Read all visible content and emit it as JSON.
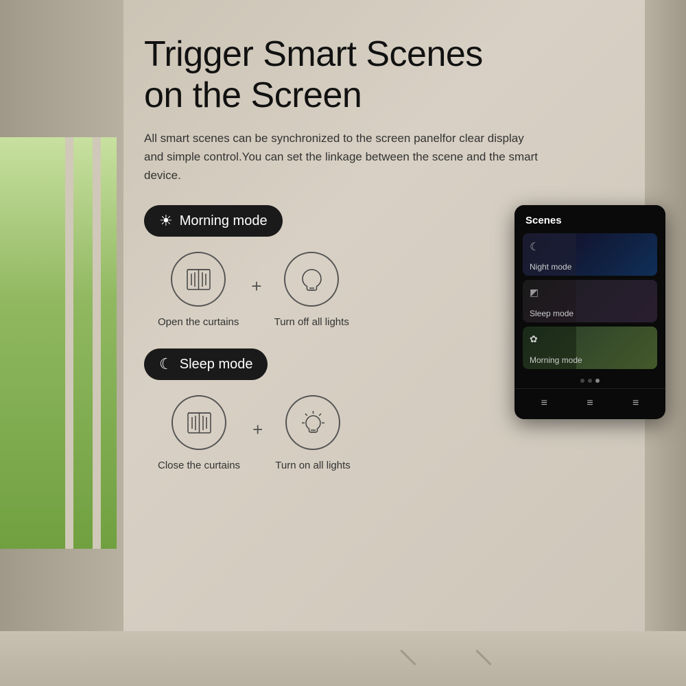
{
  "page": {
    "title_line1": "Trigger Smart Scenes",
    "title_line2": "on the Screen",
    "description": "All smart scenes can be synchronized to the screen panelfor clear display and simple control.You can set the linkage between the scene and the smart device."
  },
  "modes": [
    {
      "id": "morning",
      "badge_icon": "☀",
      "badge_label": "Morning mode",
      "actions": [
        {
          "id": "open-curtains",
          "label": "Open the curtains",
          "icon": "curtain"
        },
        {
          "id": "turn-off-lights",
          "label": "Turn off all lights",
          "icon": "light-off"
        }
      ]
    },
    {
      "id": "sleep",
      "badge_icon": "☾",
      "badge_label": "Sleep mode",
      "actions": [
        {
          "id": "close-curtains",
          "label": "Close the curtains",
          "icon": "curtain"
        },
        {
          "id": "turn-on-lights",
          "label": "Turn on all lights",
          "icon": "light-on"
        }
      ]
    }
  ],
  "device_panel": {
    "title": "Scenes",
    "scenes": [
      {
        "id": "night",
        "icon": "☾",
        "label": "Night mode"
      },
      {
        "id": "sleep",
        "icon": "◩",
        "label": "Sleep mode"
      },
      {
        "id": "morning",
        "icon": "✿",
        "label": "Morning mode"
      }
    ],
    "dots": [
      false,
      false,
      true
    ],
    "nav_icons": [
      "≡",
      "≡",
      "≡"
    ]
  }
}
